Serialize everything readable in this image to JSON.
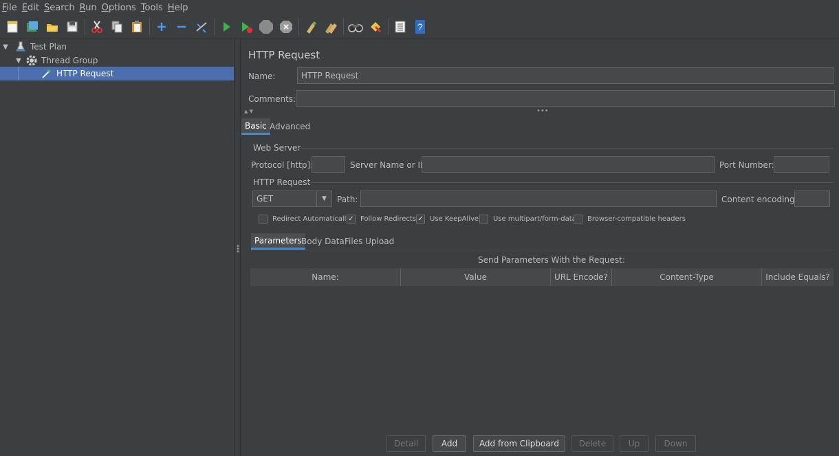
{
  "menu": {
    "items": [
      {
        "mnemonic": "F",
        "rest": "ile"
      },
      {
        "mnemonic": "E",
        "rest": "dit"
      },
      {
        "mnemonic": "S",
        "rest": "earch"
      },
      {
        "mnemonic": "R",
        "rest": "un"
      },
      {
        "mnemonic": "O",
        "rest": "ptions"
      },
      {
        "mnemonic": "T",
        "rest": "ools"
      },
      {
        "mnemonic": "H",
        "rest": "elp"
      }
    ]
  },
  "toolbar": {
    "icons": [
      "new-icon",
      "templates-icon",
      "open-icon",
      "save-icon",
      "cut-icon",
      "copy-icon",
      "paste-icon",
      "expand-icon",
      "collapse-icon",
      "toggle-icon",
      "start-icon",
      "start-no-pauses-icon",
      "stop-icon",
      "shutdown-icon",
      "clear-icon",
      "clear-all-icon",
      "search-icon",
      "reset-search-icon",
      "function-helper-icon",
      "help-icon"
    ]
  },
  "tree": {
    "test_plan": "Test Plan",
    "thread_group": "Thread Group",
    "http_request": "HTTP Request"
  },
  "editor": {
    "title": "HTTP Request",
    "name_label": "Name:",
    "name_value": "HTTP Request",
    "comments_label": "Comments:",
    "comments_value": "",
    "tabs": {
      "basic": "Basic",
      "advanced": "Advanced"
    },
    "web_server": {
      "section": "Web Server",
      "protocol_label": "Protocol [http]:",
      "protocol_value": "",
      "server_label": "Server Name or IP:",
      "server_value": "",
      "port_label": "Port Number:",
      "port_value": ""
    },
    "http_request": {
      "section": "HTTP Request",
      "method": "GET",
      "path_label": "Path:",
      "path_value": "",
      "encoding_label": "Content encoding:",
      "encoding_value": ""
    },
    "checkboxes": [
      {
        "label": "Redirect Automatically",
        "checked": false
      },
      {
        "label": "Follow Redirects",
        "checked": true
      },
      {
        "label": "Use KeepAlive",
        "checked": true
      },
      {
        "label": "Use multipart/form-data",
        "checked": false
      },
      {
        "label": "Browser-compatible headers",
        "checked": false
      }
    ],
    "subtabs": {
      "parameters": "Parameters",
      "body": "Body Data",
      "files": "Files Upload"
    },
    "params_caption": "Send Parameters With the Request:",
    "columns": [
      "Name:",
      "Value",
      "URL Encode?",
      "Content-Type",
      "Include Equals?"
    ],
    "buttons": {
      "detail": "Detail",
      "add": "Add",
      "clipboard": "Add from Clipboard",
      "delete": "Delete",
      "up": "Up",
      "down": "Down"
    }
  },
  "colors": {
    "selection": "#4b6eaf",
    "background": "#3c3f41",
    "tab_accent": "#4a88c7"
  }
}
